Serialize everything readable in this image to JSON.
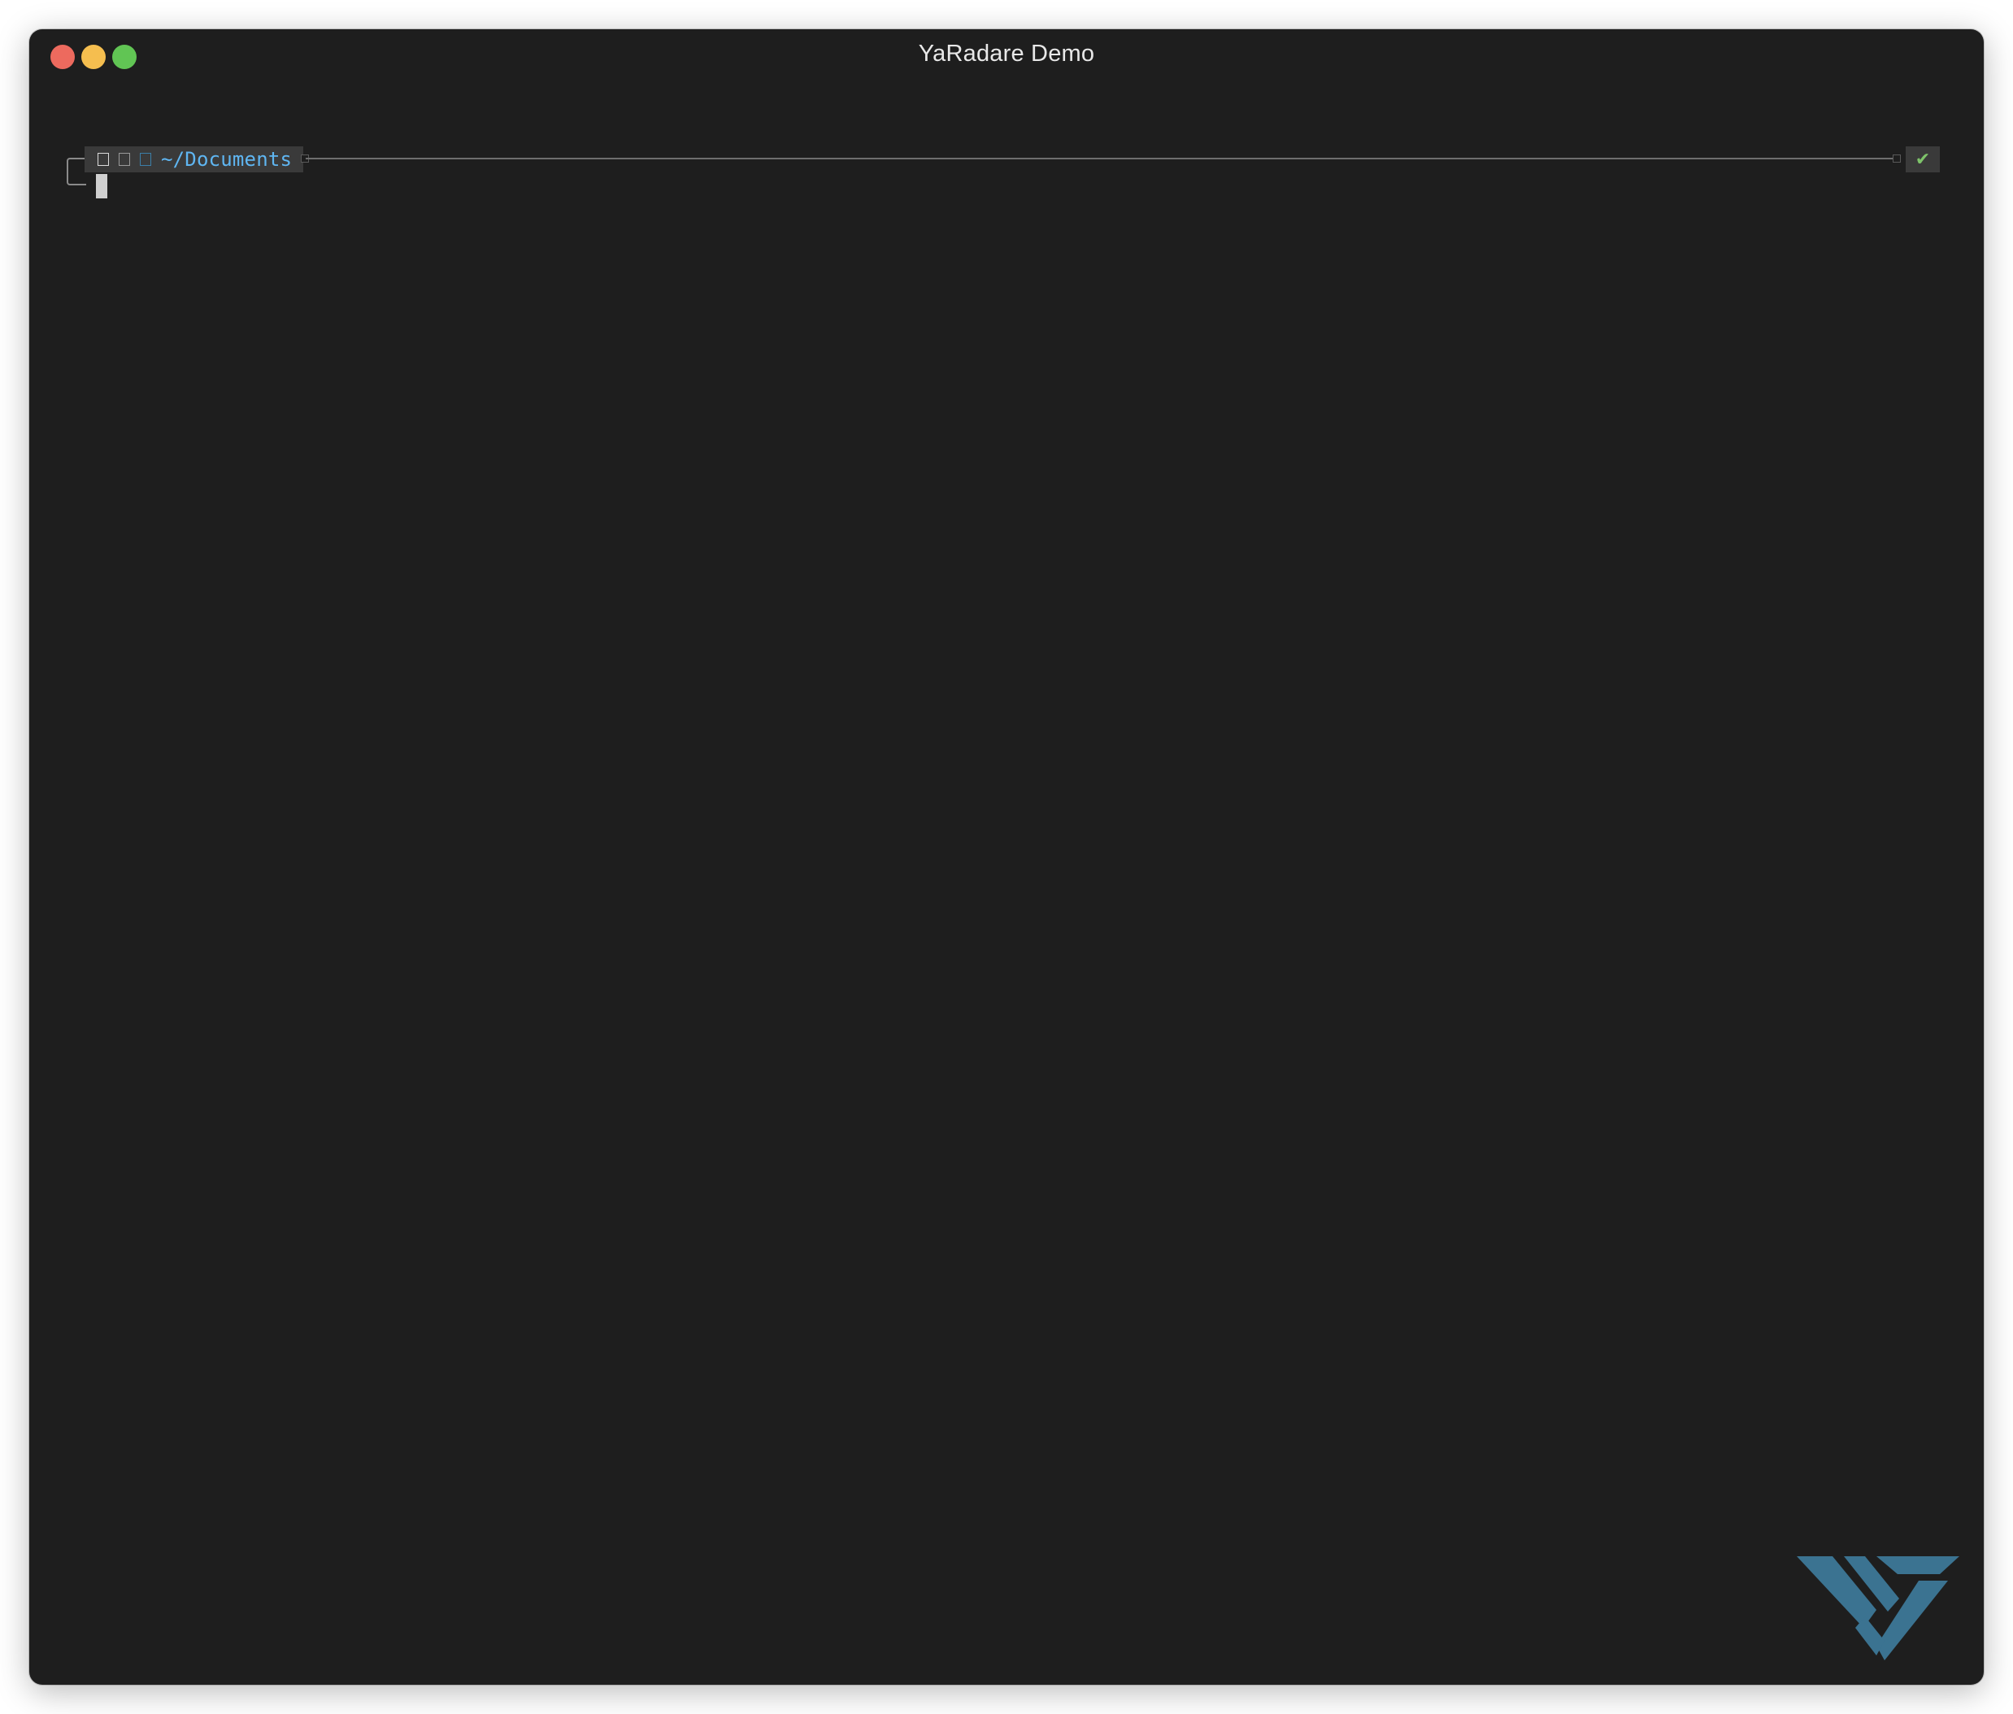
{
  "window": {
    "title": "YaRadare Demo"
  },
  "prompt": {
    "path": "~/Documents",
    "status_icon": "check-icon",
    "status_glyph": "✔",
    "status_color": "#7ec36a",
    "path_color": "#5fb6f2"
  },
  "colors": {
    "background": "#1e1e1e",
    "traffic_close": "#ed6a5e",
    "traffic_minimize": "#f5be4f",
    "traffic_maximize": "#61c554",
    "logo": "#3b7391"
  },
  "logo": {
    "icon": "triangle-logo-icon"
  }
}
